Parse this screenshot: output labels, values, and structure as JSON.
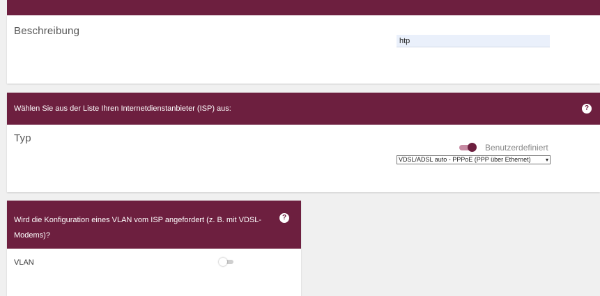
{
  "description_section": {
    "label": "Beschreibung",
    "input_value": "htp"
  },
  "isp_section": {
    "header": "Wählen Sie aus der Liste Ihren Internetdienstanbieter (ISP) aus:",
    "help": "?",
    "type_label": "Typ",
    "custom_toggle_label": "Benutzerdefiniert",
    "custom_toggle_on": true,
    "select_value": "VDSL/ADSL auto - PPPoE (PPP über Ethernet)"
  },
  "vlan_section": {
    "header_line1": "Wird die Konfiguration eines VLAN vom ISP angefordert (z. B. mit VDSL-",
    "header_line2": "Modems)?",
    "help": "?",
    "vlan_label": "VLAN",
    "vlan_toggle_on": false
  },
  "colors": {
    "brand": "#6d1f3f",
    "background": "#f0f0f0",
    "input_bg": "#eaf0fb"
  }
}
